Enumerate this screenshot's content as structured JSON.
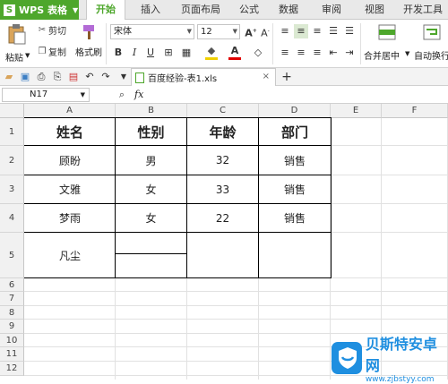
{
  "app": {
    "name": "WPS 表格",
    "icon_glyph": "S",
    "accent": "#4ea72c"
  },
  "menu": {
    "tabs": [
      "开始",
      "插入",
      "页面布局",
      "公式",
      "数据",
      "审阅",
      "视图",
      "开发工具"
    ],
    "active": "开始"
  },
  "ribbon": {
    "paste_label": "粘贴",
    "cut_label": "剪切",
    "copy_label": "复制",
    "format_painter_label": "格式刷",
    "font_name": "宋体",
    "font_size": "12",
    "bold": "B",
    "italic": "I",
    "underline": "U",
    "merge_label": "合并居中",
    "wrap_label": "自动换行"
  },
  "document": {
    "tab_title": "百度经验-表1.xls"
  },
  "formula_bar": {
    "cell_ref": "N17",
    "fx_label": "fx",
    "value": ""
  },
  "sheet": {
    "columns": [
      "A",
      "B",
      "C",
      "D",
      "E",
      "F"
    ],
    "rows": [
      "1",
      "2",
      "3",
      "4",
      "5",
      "6",
      "7",
      "8",
      "9",
      "10",
      "11",
      "12"
    ],
    "header_row": [
      "姓名",
      "性别",
      "年龄",
      "部门"
    ],
    "data_rows": [
      [
        "顾盼",
        "男",
        "32",
        "销售"
      ],
      [
        "文雅",
        "女",
        "33",
        "销售"
      ],
      [
        "梦雨",
        "女",
        "22",
        "销售"
      ]
    ],
    "merged_a5": "凡尘"
  },
  "watermark": {
    "title": "贝斯特安卓网",
    "url": "www.zjbstyy.com",
    "color": "#1f8fe0"
  }
}
